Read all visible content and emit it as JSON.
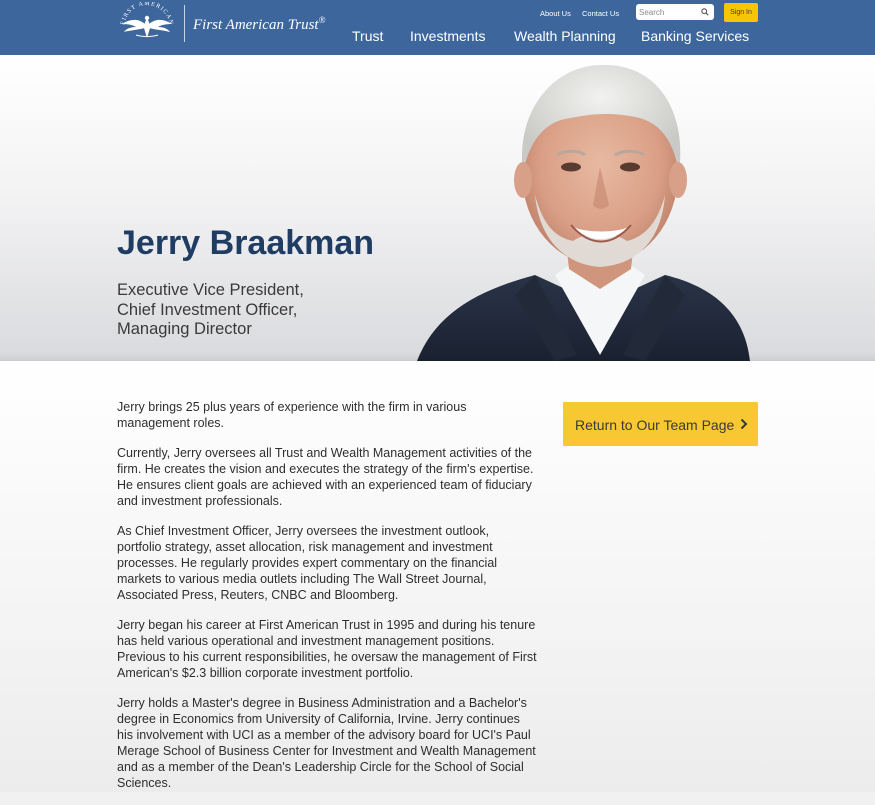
{
  "header": {
    "brand_name": "First American Trust",
    "brand_mark": "®",
    "seal_text": "FIRST AMERICAN",
    "utility_links": [
      "About Us",
      "Contact Us"
    ],
    "search_placeholder": "Search",
    "sign_in_label": "Sign In",
    "nav": [
      "Trust",
      "Investments",
      "Wealth Planning",
      "Banking Services"
    ]
  },
  "hero": {
    "name": "Jerry Braakman",
    "title_lines": [
      "Executive Vice President,",
      "Chief Investment Officer,",
      "Managing Director"
    ]
  },
  "bio": [
    "Jerry brings 25 plus years of experience with the firm in various management roles.",
    "Currently, Jerry oversees all Trust and Wealth Management activities of the firm. He creates the vision and executes the strategy of the firm's expertise. He ensures client goals are achieved with an experienced team of fiduciary and investment professionals.",
    "As Chief Investment Officer, Jerry oversees the investment outlook, portfolio strategy, asset allocation, risk management and investment processes. He regularly provides expert commentary on the financial markets to various media outlets including The Wall Street Journal, Associated Press, Reuters, CNBC and Bloomberg.",
    "Jerry began his career at First American Trust in 1995 and during his tenure has held various operational and investment management positions. Previous to his current responsibilities, he oversaw the management of First American's $2.3 billion corporate investment portfolio.",
    "Jerry holds a Master's degree in Business Administration and a Bachelor's degree in Economics from University of California, Irvine. Jerry continues his involvement with UCI as a member of the advisory board for UCI's Paul Merage School of Business Center for Investment and Wealth Management and as a member of the Dean's Leadership Circle for the School of Social Sciences."
  ],
  "sidebar": {
    "return_label": "Return to Our Team Page"
  },
  "colors": {
    "header_bg": "#3d679c",
    "accent_yellow": "#f7c831",
    "name_blue": "#1f3c63"
  },
  "icons": {
    "search": "search-icon",
    "chevron": "chevron-right-icon",
    "logo": "eagle-seal-icon"
  }
}
